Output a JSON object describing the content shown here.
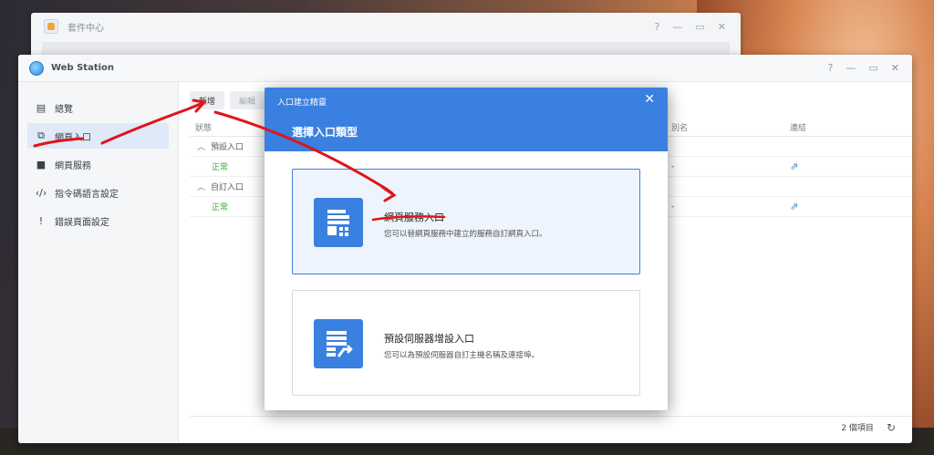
{
  "background_window": {
    "title": "套件中心",
    "controls": [
      "?",
      "—",
      "▭",
      "✕"
    ]
  },
  "window": {
    "title": "Web Station",
    "controls": [
      "?",
      "—",
      "▭",
      "✕"
    ]
  },
  "sidebar": {
    "items": [
      {
        "label": "總覽",
        "icon": "overview-icon"
      },
      {
        "label": "網頁入口",
        "icon": "portal-icon",
        "active": true
      },
      {
        "label": "網頁服務",
        "icon": "grid-icon"
      },
      {
        "label": "指令碼語言設定",
        "icon": "code-icon"
      },
      {
        "label": "錯誤頁面設定",
        "icon": "error-icon"
      }
    ]
  },
  "toolbar": {
    "add_label": "新增",
    "edit_label": "編輯"
  },
  "table": {
    "headers": {
      "status": "狀態",
      "alias": "別名",
      "link": "連結"
    },
    "groups": [
      {
        "label": "預設入口",
        "row": {
          "status": "正常",
          "alias": "-"
        }
      },
      {
        "label": "自訂入口",
        "row": {
          "status": "正常",
          "alias": "-"
        }
      }
    ]
  },
  "footer": {
    "count": "2 個項目"
  },
  "modal": {
    "title": "入口建立精靈",
    "close": "✕",
    "heading": "選擇入口類型",
    "options": [
      {
        "name": "網頁服務入口",
        "desc": "您可以替網頁服務中建立的服務自訂網頁入口。",
        "selected": true
      },
      {
        "name": "預設伺服器增設入口",
        "desc": "您可以為預設伺服器自訂主機名稱及連接埠。",
        "selected": false
      }
    ]
  },
  "colors": {
    "accent": "#3a80e0",
    "status_ok": "#3ea43e",
    "annotation": "#e0141a"
  }
}
